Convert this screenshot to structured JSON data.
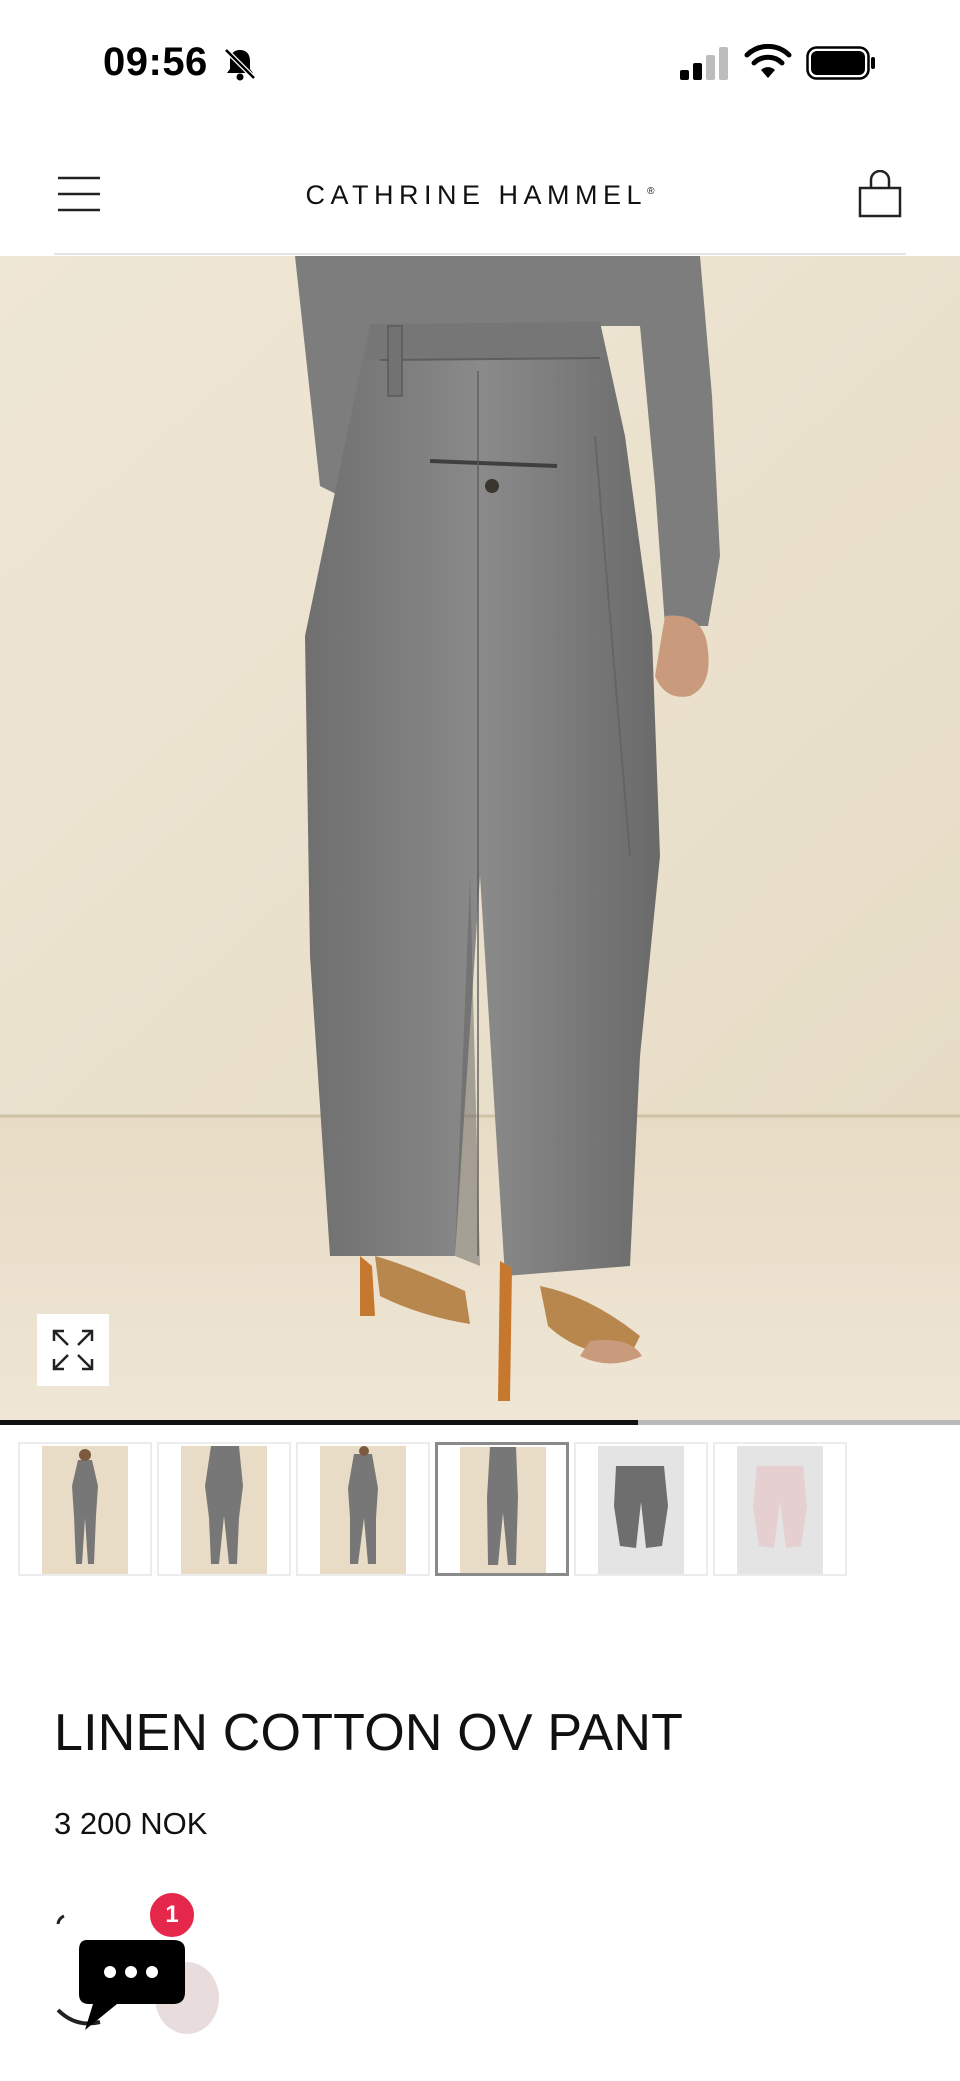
{
  "status_bar": {
    "time": "09:56",
    "icons": [
      "bell-slash-icon",
      "signal-icon",
      "wifi-icon",
      "battery-icon"
    ]
  },
  "header": {
    "brand": "CATHRINE HAMMEL",
    "brand_mark": "®",
    "menu_icon": "hamburger-menu-icon",
    "cart_icon": "shopping-bag-icon"
  },
  "gallery": {
    "expand_icon": "expand-arrows-icon",
    "progress": 0.665,
    "active_index": 3,
    "thumbnails": [
      {
        "name": "full-front"
      },
      {
        "name": "front"
      },
      {
        "name": "side"
      },
      {
        "name": "back"
      },
      {
        "name": "flat-grey"
      },
      {
        "name": "flat-pink"
      }
    ]
  },
  "product": {
    "title": "LINEN COTTON OV PANT",
    "price": "3 200 NOK"
  },
  "chat": {
    "icon": "chat-bubble-icon",
    "badge_count": "1"
  },
  "colors": {
    "fabric_grey": "#7b7b7b",
    "wall_beige": "#ece3cf",
    "badge_red": "#e4274b",
    "swatch_pink": "#e9dcdc"
  }
}
